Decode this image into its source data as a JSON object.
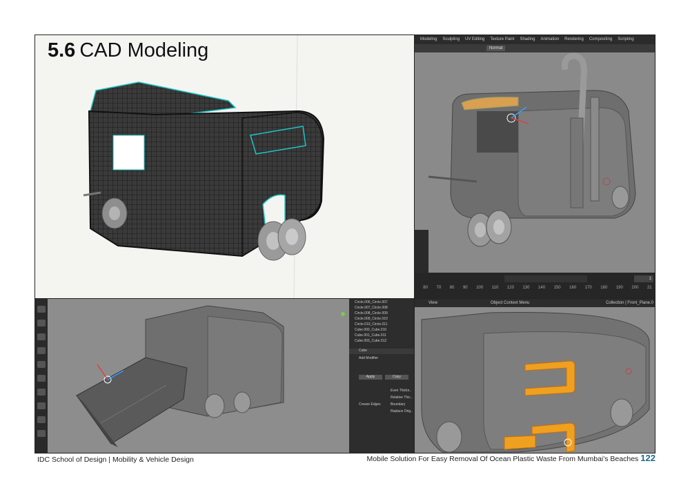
{
  "heading": {
    "number": "5.6",
    "text": "CAD Modeling"
  },
  "viewport2": {
    "workspace_tabs": [
      "Modeling",
      "Sculpting",
      "UV Editing",
      "Texture Paint",
      "Shading",
      "Animation",
      "Rendering",
      "Compositing",
      "Scripting"
    ],
    "mode": "Normal",
    "timeline_ticks": [
      "80",
      "70",
      "80",
      "90",
      "100",
      "110",
      "120",
      "130",
      "140",
      "150",
      "160",
      "170",
      "180",
      "190",
      "200",
      "21"
    ],
    "current_frame": "1"
  },
  "viewport3": {
    "outliner_rows": [
      "Circle.006_Circle.007",
      "Circle.007_Circle.008",
      "Circle.008_Circle.009",
      "Circle.009_Circle.010",
      "Circle.010_Circle.011",
      "Cube.000_Cube.010",
      "Cube.001_Cube.011",
      "Cube.003_Cube.012"
    ],
    "properties_object": "Cube",
    "add_modifier": "Add Modifier",
    "apply_label": "Apply",
    "copy_label": "Copy",
    "options": [
      "Even Thickn..",
      "Relative Thic..",
      "Boundary",
      "Replace Orig.."
    ],
    "crease_label": "Crease Edges"
  },
  "viewport4": {
    "view_label": "View",
    "menu_label": "Object Context Menu",
    "collection": "Collection | Front_Plane.0"
  },
  "footer": {
    "left": "IDC School of Design | Mobility & Vehicle Design",
    "right": "Mobile Solution For Easy Removal Of Ocean Plastic Waste From Mumbai's Beaches",
    "page": "122"
  },
  "colors": {
    "page_number": "#1d6a8a",
    "wire_highlight": "#22c8c8",
    "selected_orange": "#f0a020"
  }
}
